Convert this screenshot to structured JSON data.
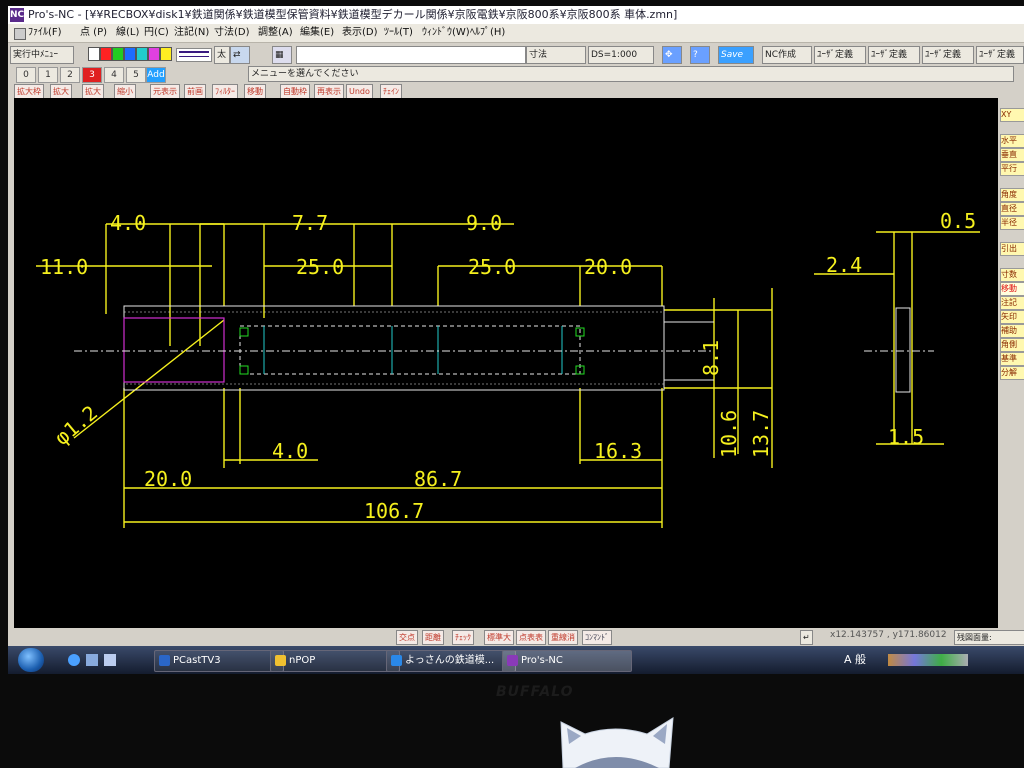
{
  "window": {
    "title": "Pro's-NC - [¥¥RECBOX¥disk1¥鉄道関係¥鉄道模型保管資料¥鉄道模型デカール関係¥京阪電鉄¥京阪800系¥京阪800系 車体.zmn]",
    "app_icon": "NC"
  },
  "menu": [
    "ﾌｧｲﾙ(F)",
    "点 (P)",
    "線(L)",
    "円(C)",
    "注記(N)",
    "寸法(D)",
    "調整(A)",
    "編集(E)",
    "表示(D)",
    "ﾂｰﾙ(T)",
    "ｳｨﾝﾄﾞｳ(W)",
    "ﾍﾙﾌﾟ(H)"
  ],
  "toolbar": {
    "running_menu": "実行中ﾒﾆｭｰ",
    "thickness": "太",
    "command_input": "",
    "dimension": "寸法",
    "ds_scale": "DS=1:000",
    "save": "Save",
    "nc_create": "NC作成",
    "user_defs": [
      "ﾕｰｻﾞ定義",
      "ﾕｰｻﾞ定義",
      "ﾕｰｻﾞ定義",
      "ﾕｰｻﾞ定義"
    ],
    "colors": [
      "#ffffff",
      "#ff2222",
      "#22cc22",
      "#1e6cff",
      "#22cccc",
      "#e040e0",
      "#ffee22"
    ]
  },
  "layers": {
    "items": [
      "0",
      "1",
      "2",
      "3",
      "4",
      "5",
      "Add"
    ],
    "active": "3",
    "message": "メニューを選んでください"
  },
  "function_bar": [
    "拡大枠",
    "拡大",
    "拡大",
    "縮小",
    "元表示",
    "前画",
    "ﾌｨﾙﾀｰ",
    "移動",
    "自動枠",
    "再表示",
    "Undo",
    "ﾁｪｲﾝ"
  ],
  "side_menu": [
    "XY",
    "水平",
    "垂直",
    "平行",
    "角度",
    "直径",
    "半径",
    "引出",
    "寸数",
    "移動",
    "注記",
    "矢印",
    "補助",
    "角側",
    "基準",
    "分解"
  ],
  "status_buttons": [
    "交点",
    "距離",
    "ﾁｪｯｸ",
    "標準大",
    "点表表",
    "重線消",
    "ｺﾝﾏﾝﾄﾞ"
  ],
  "status": {
    "coords": "x12.143757 , y171.86012",
    "remaining": "残図面量:"
  },
  "taskbar": [
    {
      "label": "PCastTV3",
      "color": "#2a66c8"
    },
    {
      "label": "nPOP",
      "color": "#f0c030"
    },
    {
      "label": "よっさんの鉄道模...",
      "color": "#2a88e8"
    },
    {
      "label": "Pro's-NC",
      "color": "#8a3ab8"
    }
  ],
  "tray": {
    "ime": "A 般"
  },
  "monitor_brand": "BUFFALO",
  "drawing": {
    "dims": {
      "d4_top": "4.0",
      "d77": "7.7",
      "d90": "9.0",
      "d110": "11.0",
      "d250a": "25.0",
      "d250b": "25.0",
      "d200": "20.0",
      "d05": "0.5",
      "d24": "2.4",
      "phi": "φ1.2",
      "d40_bot": "4.0",
      "d163": "16.3",
      "d200_bot": "20.0",
      "d867": "86.7",
      "d1067": "106.7",
      "d81": "8.1",
      "d106": "10.6",
      "d137": "13.7",
      "d15": "1.5"
    }
  }
}
